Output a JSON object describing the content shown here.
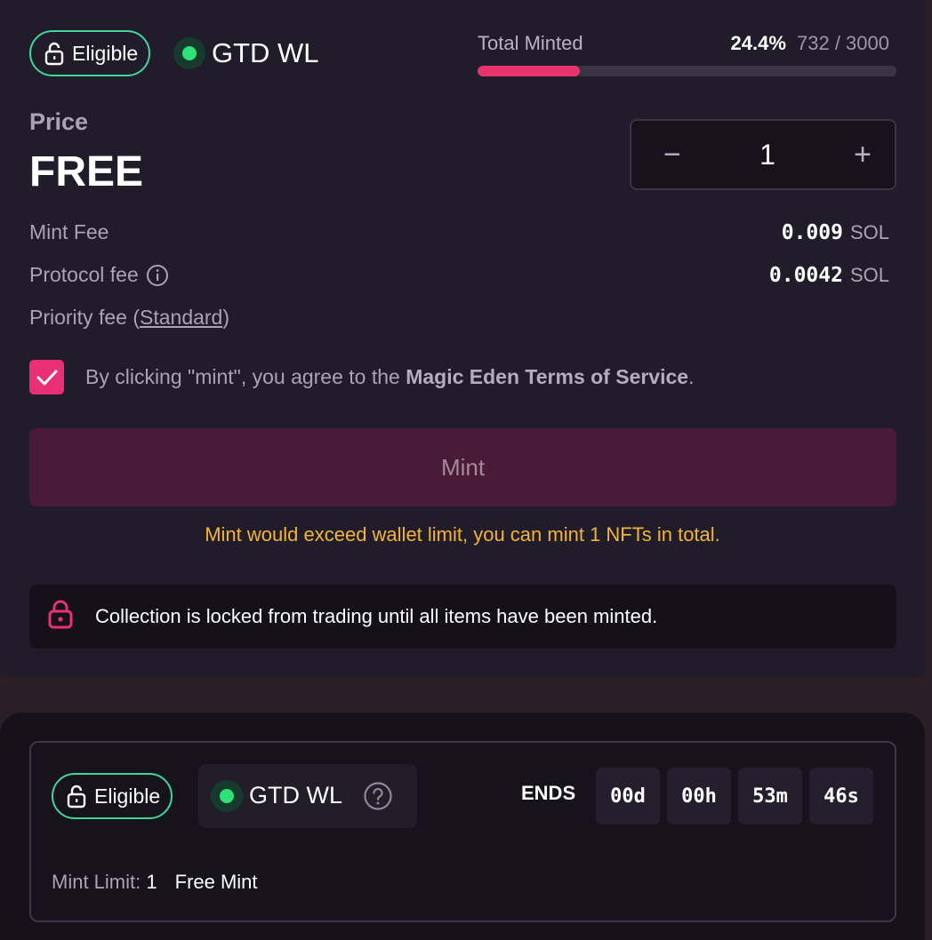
{
  "mint_panel": {
    "eligibility_label": "Eligible",
    "phase_name": "GTD WL",
    "total_minted_label": "Total Minted",
    "minted_percent": "24.4%",
    "minted_count": "732 / 3000",
    "minted_fraction": 0.244,
    "price_label": "Price",
    "price_value": "FREE",
    "quantity": "1",
    "decrement_symbol": "−",
    "increment_symbol": "+",
    "fees": [
      {
        "label": "Mint Fee",
        "amount": "0.009",
        "unit": "SOL"
      },
      {
        "label": "Protocol fee",
        "amount": "0.0042",
        "unit": "SOL"
      }
    ],
    "priority_fee_label": "Priority fee",
    "priority_fee_open": "(",
    "priority_fee_link": "Standard",
    "priority_fee_close": ")",
    "tos_prefix": "By clicking \"mint\", you agree to the ",
    "tos_link": "Magic Eden Terms of Service",
    "tos_suffix": ".",
    "mint_button_label": "Mint",
    "warning": "Mint would exceed wallet limit, you can mint 1 NFTs in total.",
    "lock_notice": "Collection is locked from trading until all items have been minted."
  },
  "phase_card": {
    "eligibility_label": "Eligible",
    "phase_name": "GTD WL",
    "ends_label": "ENDS",
    "countdown": [
      "00d",
      "00h",
      "53m",
      "46s"
    ],
    "mint_limit_label": "Mint Limit:",
    "mint_limit_value": "1",
    "mint_type": "Free Mint"
  },
  "colors": {
    "accent_pink": "#ea2f74",
    "eligible_green": "#3fd79a",
    "warning_yellow": "#f3b436"
  }
}
